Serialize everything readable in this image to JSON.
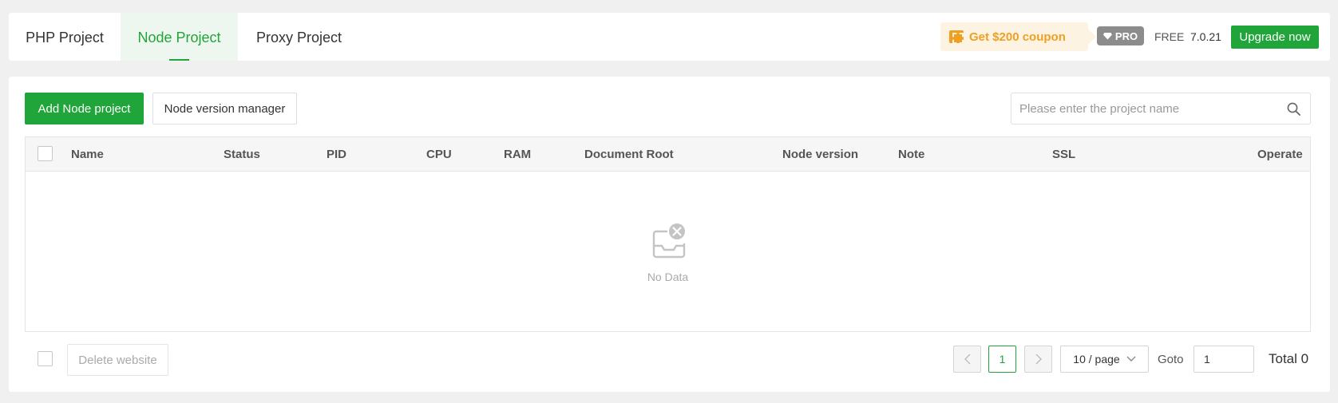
{
  "tabs": [
    {
      "label": "PHP Project"
    },
    {
      "label": "Node Project",
      "active": true
    },
    {
      "label": "Proxy Project"
    }
  ],
  "header": {
    "coupon": "Get $200 coupon",
    "pro": "PRO",
    "free": "FREE",
    "version": "7.0.21",
    "upgrade": "Upgrade now"
  },
  "toolbar": {
    "add_label": "Add Node project",
    "version_manager_label": "Node version manager",
    "search_placeholder": "Please enter the project name"
  },
  "table": {
    "columns": [
      "Name",
      "Status",
      "PID",
      "CPU",
      "RAM",
      "Document Root",
      "Node version",
      "Note",
      "SSL",
      "Operate"
    ],
    "rows": [],
    "empty_text": "No Data"
  },
  "footer": {
    "delete_label": "Delete website",
    "current_page": "1",
    "page_size": "10 / page",
    "goto_label": "Goto",
    "goto_value": "1",
    "total": "Total 0"
  },
  "colors": {
    "accent": "#20a53a",
    "coupon": "#f0a020",
    "background": "#f0f0f0"
  },
  "icons": [
    "coupon-icon",
    "diamond-icon",
    "search-icon",
    "no-data-icon",
    "chevron-left-icon",
    "chevron-right-icon",
    "chevron-down-icon"
  ]
}
